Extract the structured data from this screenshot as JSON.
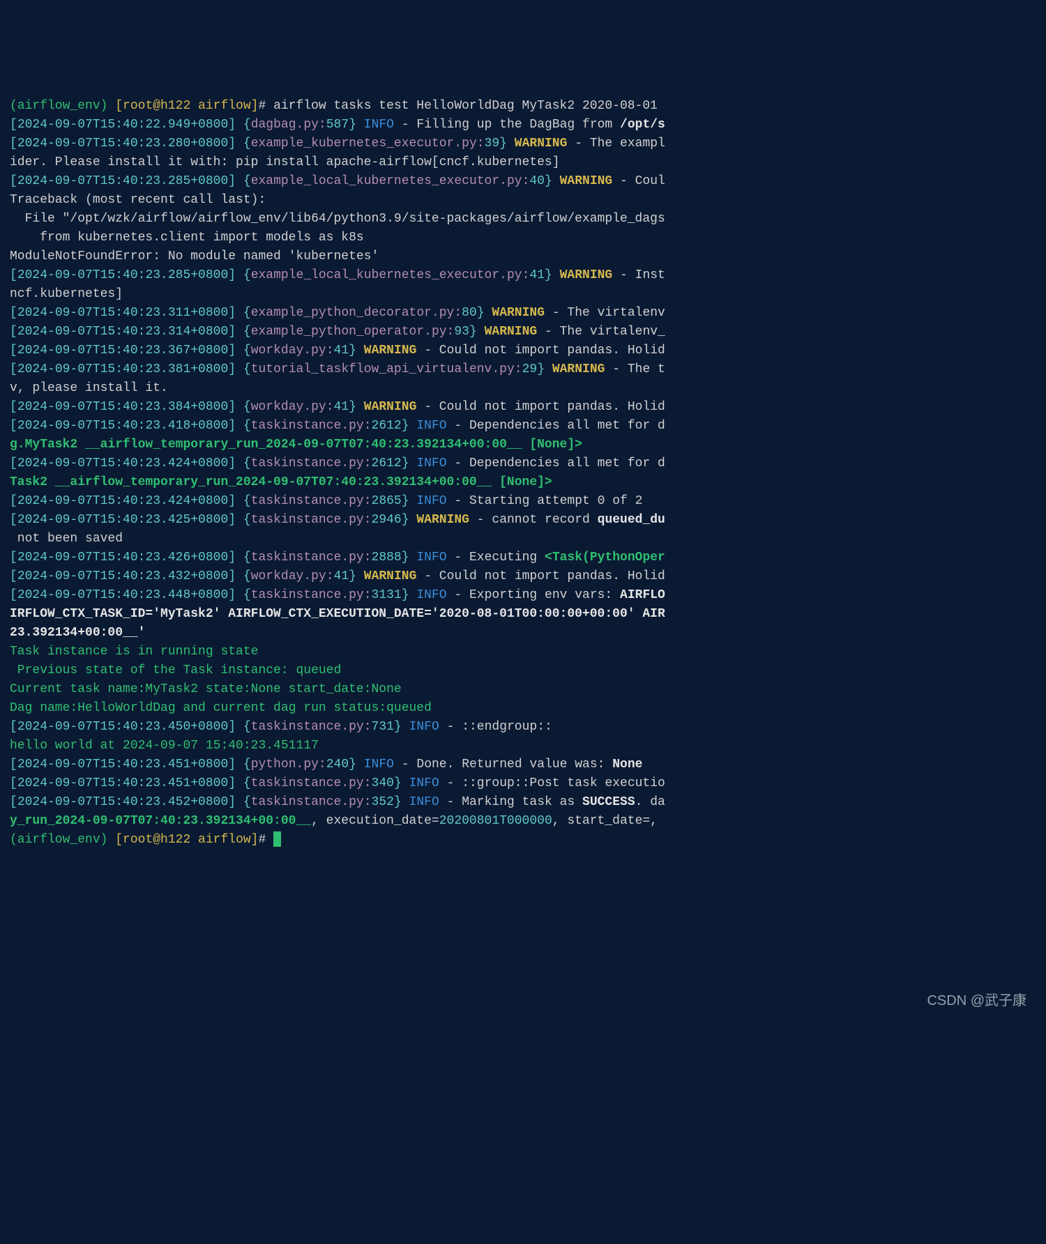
{
  "prompt": {
    "venv": "(airflow_env) ",
    "user_host": "[root@h122 airflow]",
    "hash": "# ",
    "cmd": "airflow tasks test HelloWorldDag MyTask2 2020-08-01"
  },
  "ts": {
    "t0": "2024-09-07T15:40:22.949+0800",
    "t1": "2024-09-07T15:40:23.280+0800",
    "t2": "2024-09-07T15:40:23.285+0800",
    "t3": "2024-09-07T15:40:23.285+0800",
    "t4": "2024-09-07T15:40:23.311+0800",
    "t5": "2024-09-07T15:40:23.314+0800",
    "t6": "2024-09-07T15:40:23.367+0800",
    "t7": "2024-09-07T15:40:23.381+0800",
    "t8": "2024-09-07T15:40:23.384+0800",
    "t9": "2024-09-07T15:40:23.418+0800",
    "t10": "2024-09-07T15:40:23.424+0800",
    "t11": "2024-09-07T15:40:23.424+0800",
    "t12": "2024-09-07T15:40:23.425+0800",
    "t13": "2024-09-07T15:40:23.426+0800",
    "t14": "2024-09-07T15:40:23.432+0800",
    "t15": "2024-09-07T15:40:23.448+0800",
    "t16": "2024-09-07T15:40:23.450+0800",
    "t17": "2024-09-07T15:40:23.451+0800",
    "t18": "2024-09-07T15:40:23.451+0800",
    "t19": "2024-09-07T15:40:23.452+0800"
  },
  "src": {
    "dagbag": "dagbag.py:",
    "dagbag_l": "587",
    "ekex": "example_kubernetes_executor.py:",
    "ekex_l": "39",
    "elke": "example_local_kubernetes_executor.py:",
    "elke_l40": "40",
    "elke_l41": "41",
    "epd": "example_python_decorator.py:",
    "epd_l": "80",
    "epo": "example_python_operator.py:",
    "epo_l": "93",
    "wkd": "workday.py:",
    "wkd_l": "41",
    "ttv": "tutorial_taskflow_api_virtualenv.py:",
    "ttv_l": "29",
    "ti": "taskinstance.py:",
    "ti_2612": "2612",
    "ti_2865": "2865",
    "ti_2946": "2946",
    "ti_2888": "2888",
    "ti_3131": "3131",
    "ti_731": "731",
    "ti_340": "340",
    "ti_352": "352",
    "py": "python.py:",
    "py_l": "240"
  },
  "lvl": {
    "info": "INFO",
    "warn": "WARNING"
  },
  "txt": {
    "brk_l": "[",
    "brk_r": "]",
    "cb_l": "{",
    "cb_r": "}",
    "dash": " - ",
    "fill": "Filling up the DagBag from ",
    "fill_path": "/opt/s",
    "ekex_msg": "The exampl",
    "ider": "ider. Please install it with: pip install apache-airflow[cncf.kubernetes]",
    "coul": "Coul",
    "tb": "Traceback (most recent call last):",
    "tb_file": "  File \"/opt/wzk/airflow/airflow_env/lib64/python3.9/site-packages/airflow/example_dags",
    "tb_import": "    from kubernetes.client import models as k8s",
    "mnf": "ModuleNotFoundError: No module named 'kubernetes'",
    "inst": "Inst",
    "ncf": "ncf.kubernetes]",
    "virt": "The virtalenv",
    "virt2": "The virtalenv_",
    "pandas": "Could not import pandas. Holid",
    "the_t": "The t",
    "vinst": "v, please install it.",
    "deps": "Dependencies all met for d",
    "run1": "g.MyTask2 __airflow_temporary_run_2024-09-07T07:40:23.392134+00:00__ [None]>",
    "run2": "Task2 __airflow_temporary_run_2024-09-07T07:40:23.392134+00:00__ [None]>",
    "start": "Starting attempt 0 of 2",
    "cannot": "cannot record ",
    "queued_du": "queued_du",
    "not_saved": " not been saved",
    "exec": "Executing ",
    "task_op": "<Task(PythonOper",
    "export": "Exporting env vars: ",
    "airflo": "AIRFLO",
    "ctx": "IRFLOW_CTX_TASK_ID='MyTask2' AIRFLOW_CTX_EXECUTION_DATE='2020-08-01T00:00:00+00:00' AIR",
    "ctx2": "23.392134+00:00__'",
    "ti_run": "Task instance is in running state",
    "prev": " Previous state of the Task instance: queued",
    "cur": "Current task name:MyTask2 state:None start_date:None",
    "dagname": "Dag name:HelloWorldDag and current dag run status:queued",
    "endgroup": "::endgroup::",
    "hello": "hello world at 2024-09-07 15:40:23.451117",
    "done": "Done. Returned value was: ",
    "none": "None",
    "group_post": "::group::Post task executio",
    "marking": "Marking task as ",
    "success": "SUCCESS",
    "dot_da": ". da",
    "yrun": "y_run_2024-09-07T07:40:23.392134+00:00__",
    "execdate": ", execution_date=",
    "execdate_v": "20200801T000000",
    "startdate": ", start_date=, "
  },
  "watermark": "CSDN @武子康"
}
